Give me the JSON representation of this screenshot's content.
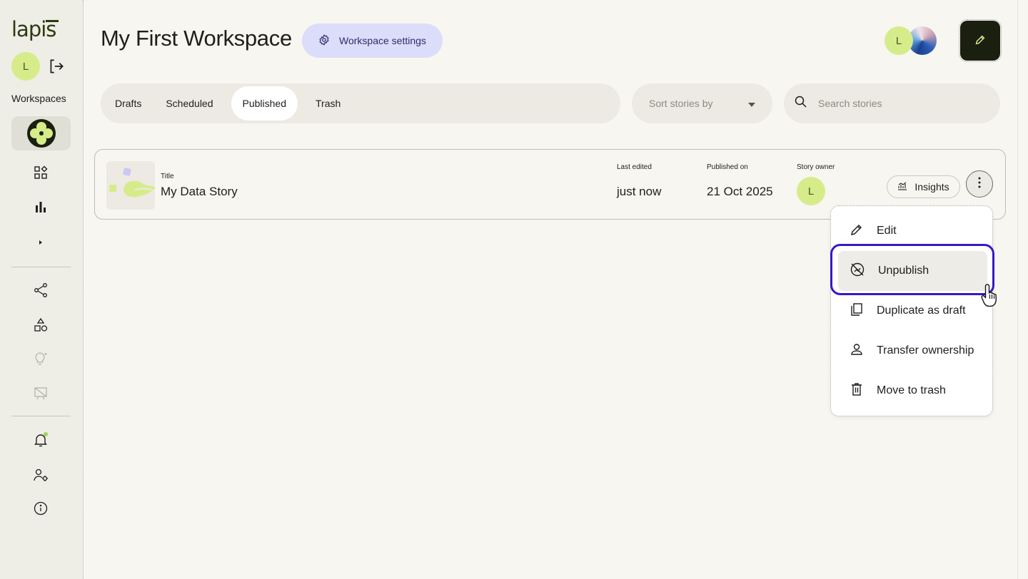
{
  "app": {
    "logo_text": "lapis",
    "accent": "#d6ec8a",
    "highlight": "#3a17c9"
  },
  "sidebar": {
    "user_initial": "L",
    "workspaces_label": "Workspaces",
    "icons": [
      "workspace-logo-icon",
      "dashboard-grid-icon",
      "bar-chart-icon",
      "caret-right-icon",
      "share-icon",
      "shapes-icon",
      "lightbulb-icon",
      "presentation-icon",
      "bell-icon",
      "user-settings-icon",
      "info-icon"
    ]
  },
  "header": {
    "title": "My First Workspace",
    "settings_label": "Workspace settings",
    "user_initial": "L"
  },
  "tabs": [
    {
      "label": "Drafts"
    },
    {
      "label": "Scheduled"
    },
    {
      "label": "Published"
    },
    {
      "label": "Trash"
    }
  ],
  "active_tab": "Published",
  "sort": {
    "placeholder": "Sort stories by"
  },
  "search": {
    "placeholder": "Search stories",
    "value": ""
  },
  "story": {
    "title_label": "Title",
    "title": "My Data Story",
    "last_edited_label": "Last edited",
    "last_edited": "just now",
    "published_label": "Published on",
    "published": "21 Oct 2025",
    "owner_label": "Story owner",
    "owner_initial": "L",
    "insights_label": "Insights"
  },
  "menu": {
    "items": [
      {
        "label": "Edit",
        "icon": "pencil-icon"
      },
      {
        "label": "Unpublish",
        "icon": "unpublish-icon"
      },
      {
        "label": "Duplicate as draft",
        "icon": "duplicate-icon"
      },
      {
        "label": "Transfer ownership",
        "icon": "person-icon"
      },
      {
        "label": "Move to trash",
        "icon": "trash-icon"
      }
    ],
    "highlighted": "Unpublish"
  }
}
